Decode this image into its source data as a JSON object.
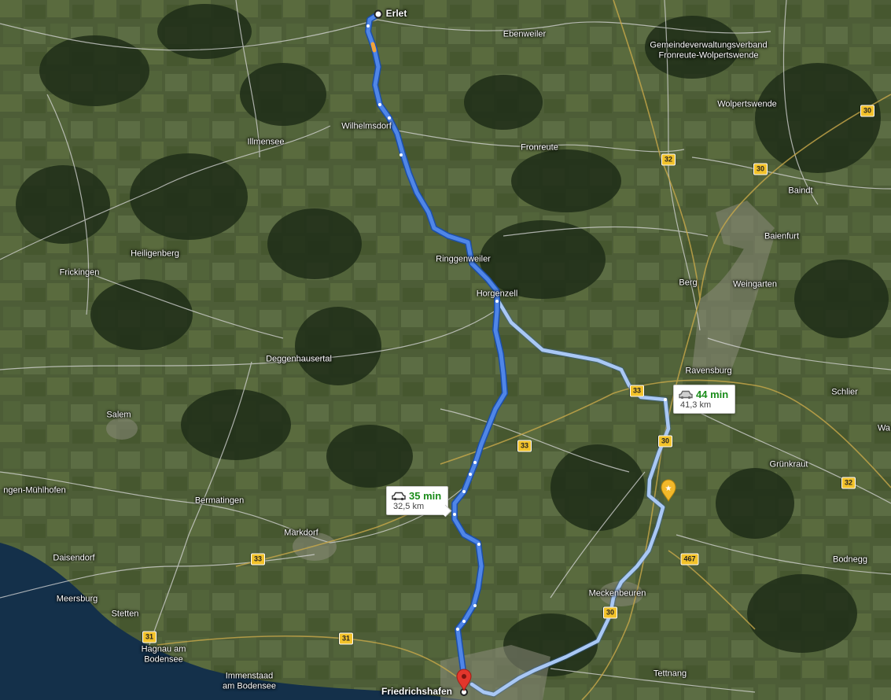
{
  "map": {
    "type": "satellite",
    "colors": {
      "primary_route": "#4f86e8",
      "alt_route": "#a9c8f5",
      "road": "#d8d8d8",
      "shield": "#f2c22a",
      "destination_pin": "#e2362c",
      "poi_star": "#f2b82a"
    }
  },
  "places": [
    {
      "name": "Erlet",
      "style": "bold"
    },
    {
      "name": "Ebenweiler"
    },
    {
      "name": "Gemeindeverwaltungsverband\nFronreute-Wolpertswende"
    },
    {
      "name": "Wolpertswende"
    },
    {
      "name": "Wilhelmsdorf"
    },
    {
      "name": "Illmensee"
    },
    {
      "name": "Fronreute"
    },
    {
      "name": "Baindt"
    },
    {
      "name": "Baienfurt"
    },
    {
      "name": "Heiligenberg"
    },
    {
      "name": "Frickingen"
    },
    {
      "name": "Ringgenweiler"
    },
    {
      "name": "Horgenzell"
    },
    {
      "name": "Berg"
    },
    {
      "name": "Weingarten"
    },
    {
      "name": "Deggenhausertal"
    },
    {
      "name": "Ravensburg"
    },
    {
      "name": "Schlier"
    },
    {
      "name": "Salem"
    },
    {
      "name": "Wa"
    },
    {
      "name": "Grünkraut"
    },
    {
      "name": "ngen-Mühlhofen"
    },
    {
      "name": "Bermatingen"
    },
    {
      "name": "Markdorf"
    },
    {
      "name": "Daisendorf"
    },
    {
      "name": "Bodnegg"
    },
    {
      "name": "Meersburg"
    },
    {
      "name": "Stetten"
    },
    {
      "name": "Meckenbeuren"
    },
    {
      "name": "Hagnau am\nBodensee"
    },
    {
      "name": "Immenstaad\nam Bodensee"
    },
    {
      "name": "Tettnang"
    },
    {
      "name": "Friedrichshafen",
      "style": "bold"
    }
  ],
  "road_shields": [
    "30",
    "32",
    "30",
    "33",
    "30",
    "33",
    "32",
    "467",
    "33",
    "30",
    "31",
    "31"
  ],
  "routes": {
    "primary": {
      "duration": "35 min",
      "distance": "32,5 km",
      "icon": "car-icon"
    },
    "alternative": {
      "duration": "44 min",
      "distance": "41,3 km",
      "icon": "car-icon"
    }
  },
  "origin": {
    "name": "Erlet"
  },
  "destination": {
    "name": "Friedrichshafen"
  }
}
